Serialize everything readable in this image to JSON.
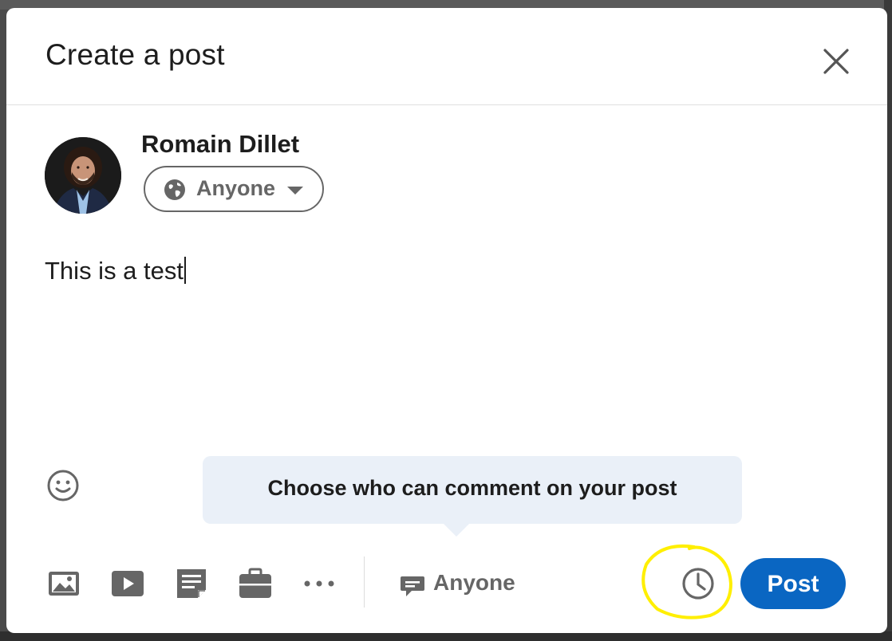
{
  "modal": {
    "title": "Create a post",
    "close_icon": "close-icon"
  },
  "author": {
    "name": "Romain Dillet",
    "avatar": "avatar-photo"
  },
  "visibility": {
    "label": "Anyone",
    "icon": "globe-icon"
  },
  "editor": {
    "text": "This is a test"
  },
  "tooltip": {
    "text": "Choose who can comment on your post"
  },
  "toolbar": {
    "icons": [
      "photo-icon",
      "video-icon",
      "document-icon",
      "job-icon",
      "more-icon"
    ],
    "comment_control_label": "Anyone",
    "comment_control_icon": "comment-icon",
    "schedule_icon": "clock-icon",
    "post_label": "Post"
  },
  "colors": {
    "primary": "#0a66c2",
    "tooltip_bg": "#eaf0f8",
    "highlight": "#ffef00",
    "text": "#1d1d1d",
    "muted": "#666666"
  }
}
